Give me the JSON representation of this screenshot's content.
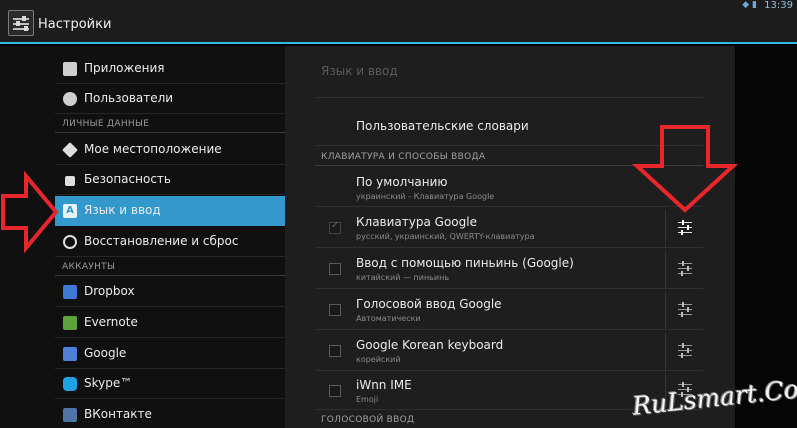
{
  "actionbar": {
    "title": "Настройки",
    "time": "13:39"
  },
  "left": {
    "items_top": [
      {
        "label": "Приложения",
        "icon": "apps-icon"
      },
      {
        "label": "Пользователи",
        "icon": "users-icon"
      }
    ],
    "section_personal": "ЛИЧНЫЕ ДАННЫЕ",
    "items_personal": [
      {
        "label": "Мое местоположение",
        "icon": "location-icon"
      },
      {
        "label": "Безопасность",
        "icon": "lock-icon"
      },
      {
        "label": "Язык и ввод",
        "icon": "language-icon"
      },
      {
        "label": "Восстановление и сброс",
        "icon": "restore-icon"
      }
    ],
    "section_accounts": "АККАУНТЫ",
    "accounts": [
      {
        "label": "Dropbox",
        "color": "#3d7ad6"
      },
      {
        "label": "Evernote",
        "color": "#5ea33a"
      },
      {
        "label": "Google",
        "color": "#4f7fd8"
      },
      {
        "label": "Skype™",
        "color": "#1fa3e0"
      },
      {
        "label": "ВКонтакте",
        "color": "#4e74a6"
      }
    ]
  },
  "right": {
    "title": "Язык и ввод",
    "user_dict": "Пользовательские словари",
    "section_keyboard": "КЛАВИАТУРА И СПОСОБЫ ВВОДА",
    "default": {
      "main": "По умолчанию",
      "sub": "украинский - Клавиатура Google"
    },
    "keyboards": [
      {
        "main": "Клавиатура Google",
        "sub": "русский, украинский, QWERTY-клавиатура",
        "checked": true
      },
      {
        "main": "Ввод с помощью пиньинь (Google)",
        "sub": "китайский — пиньинь",
        "checked": false
      },
      {
        "main": "Голосовой ввод Google",
        "sub": "Автоматически",
        "checked": false
      },
      {
        "main": "Google Korean keyboard",
        "sub": "корейский",
        "checked": false
      },
      {
        "main": "iWnn IME",
        "sub": "Emoji",
        "checked": false
      }
    ],
    "section_voice": "ГОЛОСОВОЙ ВВОД"
  },
  "watermark": "RuLsmart.Com",
  "colors": {
    "accent": "#33b5e5",
    "selected": "#3399cc",
    "arrow": "#e8262b"
  }
}
